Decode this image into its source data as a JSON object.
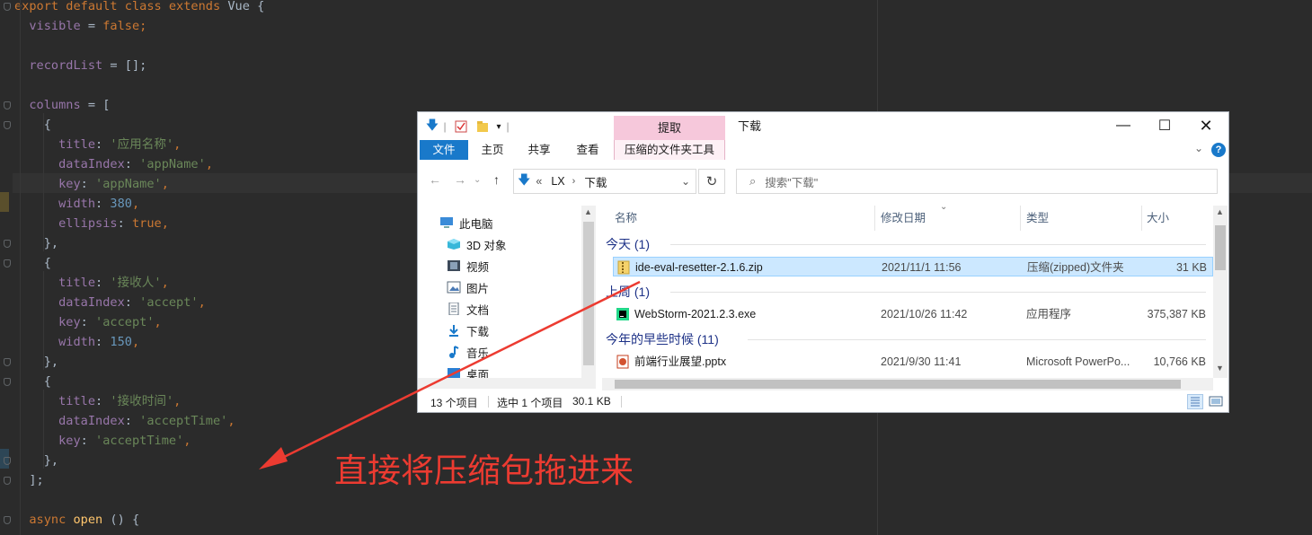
{
  "editor": {
    "lines": [
      [
        {
          "t": "export default class extends ",
          "c": "kw"
        },
        {
          "t": "Vue {",
          "c": "pl"
        }
      ],
      [
        {
          "t": "  visible",
          "c": "prop"
        },
        {
          "t": " = ",
          "c": "pl"
        },
        {
          "t": "false",
          "c": "kw"
        },
        {
          "t": ";",
          "c": "kw"
        }
      ],
      [],
      [
        {
          "t": "  recordList",
          "c": "prop"
        },
        {
          "t": " = [];",
          "c": "pl"
        }
      ],
      [],
      [
        {
          "t": "  columns",
          "c": "prop"
        },
        {
          "t": " = [",
          "c": "pl"
        }
      ],
      [
        {
          "t": "    {",
          "c": "pl"
        }
      ],
      [
        {
          "t": "      title",
          "c": "prop"
        },
        {
          "t": ": ",
          "c": "pl"
        },
        {
          "t": "'应用名称'",
          "c": "str"
        },
        {
          "t": ",",
          "c": "kw"
        }
      ],
      [
        {
          "t": "      dataIndex",
          "c": "prop"
        },
        {
          "t": ": ",
          "c": "pl"
        },
        {
          "t": "'appName'",
          "c": "str"
        },
        {
          "t": ",",
          "c": "kw"
        }
      ],
      [
        {
          "t": "      key",
          "c": "prop"
        },
        {
          "t": ": ",
          "c": "pl"
        },
        {
          "t": "'appName'",
          "c": "str"
        },
        {
          "t": ",",
          "c": "kw"
        }
      ],
      [
        {
          "t": "      width",
          "c": "prop"
        },
        {
          "t": ": ",
          "c": "pl"
        },
        {
          "t": "380",
          "c": "num"
        },
        {
          "t": ",",
          "c": "kw"
        }
      ],
      [
        {
          "t": "      ellipsis",
          "c": "prop"
        },
        {
          "t": ": ",
          "c": "pl"
        },
        {
          "t": "true",
          "c": "kw"
        },
        {
          "t": ",",
          "c": "kw"
        }
      ],
      [
        {
          "t": "    },",
          "c": "pl"
        }
      ],
      [
        {
          "t": "    {",
          "c": "pl"
        }
      ],
      [
        {
          "t": "      title",
          "c": "prop"
        },
        {
          "t": ": ",
          "c": "pl"
        },
        {
          "t": "'接收人'",
          "c": "str"
        },
        {
          "t": ",",
          "c": "kw"
        }
      ],
      [
        {
          "t": "      dataIndex",
          "c": "prop"
        },
        {
          "t": ": ",
          "c": "pl"
        },
        {
          "t": "'accept'",
          "c": "str"
        },
        {
          "t": ",",
          "c": "kw"
        }
      ],
      [
        {
          "t": "      key",
          "c": "prop"
        },
        {
          "t": ": ",
          "c": "pl"
        },
        {
          "t": "'accept'",
          "c": "str"
        },
        {
          "t": ",",
          "c": "kw"
        }
      ],
      [
        {
          "t": "      width",
          "c": "prop"
        },
        {
          "t": ": ",
          "c": "pl"
        },
        {
          "t": "150",
          "c": "num"
        },
        {
          "t": ",",
          "c": "kw"
        }
      ],
      [
        {
          "t": "    },",
          "c": "pl"
        }
      ],
      [
        {
          "t": "    {",
          "c": "pl"
        }
      ],
      [
        {
          "t": "      title",
          "c": "prop"
        },
        {
          "t": ": ",
          "c": "pl"
        },
        {
          "t": "'接收时间'",
          "c": "str"
        },
        {
          "t": ",",
          "c": "kw"
        }
      ],
      [
        {
          "t": "      dataIndex",
          "c": "prop"
        },
        {
          "t": ": ",
          "c": "pl"
        },
        {
          "t": "'acceptTime'",
          "c": "str"
        },
        {
          "t": ",",
          "c": "kw"
        }
      ],
      [
        {
          "t": "      key",
          "c": "prop"
        },
        {
          "t": ": ",
          "c": "pl"
        },
        {
          "t": "'acceptTime'",
          "c": "str"
        },
        {
          "t": ",",
          "c": "kw"
        }
      ],
      [
        {
          "t": "    },",
          "c": "pl"
        }
      ],
      [
        {
          "t": "  ];",
          "c": "pl"
        }
      ],
      [],
      [
        {
          "t": "  async ",
          "c": "kw"
        },
        {
          "t": "open",
          "c": "fn"
        },
        {
          "t": " () {",
          "c": "pl"
        }
      ]
    ]
  },
  "explorer": {
    "ribbon_context_tab": "提取",
    "window_title": "下载",
    "tabs": [
      "文件",
      "主页",
      "共享",
      "查看"
    ],
    "context_tools_tab": "压缩的文件夹工具",
    "help_label": "?",
    "address": {
      "prefix": "«",
      "segments": [
        "LX",
        "下载"
      ]
    },
    "search_placeholder": "搜索\"下载\"",
    "nav_items": [
      {
        "label": "此电脑",
        "icon": "computer-icon"
      },
      {
        "label": "3D 对象",
        "icon": "cube-icon"
      },
      {
        "label": "视频",
        "icon": "video-icon"
      },
      {
        "label": "图片",
        "icon": "picture-icon"
      },
      {
        "label": "文档",
        "icon": "document-icon"
      },
      {
        "label": "下载",
        "icon": "download-icon"
      },
      {
        "label": "音乐",
        "icon": "music-icon"
      },
      {
        "label": "桌面",
        "icon": "desktop-icon"
      }
    ],
    "columns": [
      "名称",
      "修改日期",
      "类型",
      "大小"
    ],
    "groups": [
      {
        "label": "今天 (1)",
        "files": [
          {
            "name": "ide-eval-resetter-2.1.6.zip",
            "date": "2021/11/1 11:56",
            "type": "压缩(zipped)文件夹",
            "size": "31 KB",
            "icon": "zip-icon",
            "selected": true
          }
        ]
      },
      {
        "label": "上周 (1)",
        "files": [
          {
            "name": "WebStorm-2021.2.3.exe",
            "date": "2021/10/26 11:42",
            "type": "应用程序",
            "size": "375,387 KB",
            "icon": "webstorm-icon",
            "selected": false
          }
        ]
      },
      {
        "label": "今年的早些时候 (11)",
        "files": [
          {
            "name": "前端行业展望.pptx",
            "date": "2021/9/30 11:41",
            "type": "Microsoft PowerPo...",
            "size": "10,766 KB",
            "icon": "pptx-icon",
            "selected": false
          }
        ]
      }
    ],
    "status": {
      "count": "13 个项目",
      "selected": "选中 1 个项目",
      "size": "30.1 KB"
    }
  },
  "annotation": {
    "caption": "直接将压缩包拖进来",
    "color": "#ec3b31"
  }
}
